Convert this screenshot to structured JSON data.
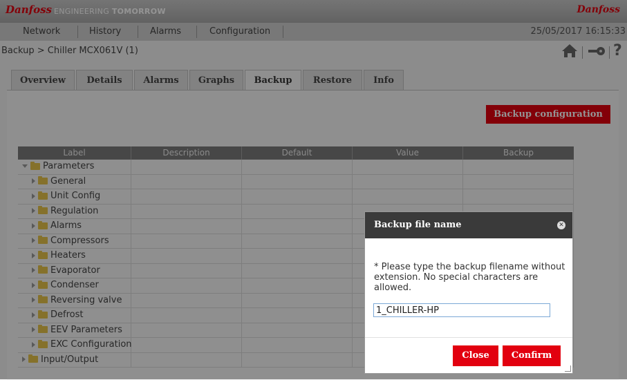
{
  "brand": {
    "logo_left": "Danfoss",
    "tagline_a": "ENGINEERING ",
    "tagline_b": "TOMORROW",
    "logo_right": "Danfoss",
    "accent": "#e2000f"
  },
  "menu": {
    "items": [
      "Network",
      "History",
      "Alarms",
      "Configuration"
    ],
    "datetime": "25/05/2017 16:15:33"
  },
  "breadcrumb": "Backup > Chiller MCX061V (1)",
  "header_icons": [
    "home-icon",
    "key-icon",
    "help-icon"
  ],
  "help_glyph": "?",
  "tabs": [
    {
      "label": "Overview"
    },
    {
      "label": "Details"
    },
    {
      "label": "Alarms"
    },
    {
      "label": "Graphs"
    },
    {
      "label": "Backup",
      "active": true
    },
    {
      "label": "Restore"
    },
    {
      "label": "Info"
    }
  ],
  "backup_button": "Backup configuration",
  "table": {
    "columns": [
      "Label",
      "Description",
      "Default",
      "Value",
      "Backup"
    ],
    "rows": [
      {
        "label": "Parameters",
        "level": 0,
        "expanded": true
      },
      {
        "label": "General",
        "level": 1
      },
      {
        "label": "Unit Config",
        "level": 1
      },
      {
        "label": "Regulation",
        "level": 1
      },
      {
        "label": "Alarms",
        "level": 1
      },
      {
        "label": "Compressors",
        "level": 1
      },
      {
        "label": "Heaters",
        "level": 1
      },
      {
        "label": "Evaporator",
        "level": 1
      },
      {
        "label": "Condenser",
        "level": 1
      },
      {
        "label": "Reversing valve",
        "level": 1
      },
      {
        "label": "Defrost",
        "level": 1
      },
      {
        "label": "EEV Parameters",
        "level": 1
      },
      {
        "label": "EXC Configuration",
        "level": 1
      },
      {
        "label": "Input/Output",
        "level": 0
      }
    ]
  },
  "dialog": {
    "title": "Backup file name",
    "message": "* Please type the backup filename without extension. No special characters are allowed.",
    "input_value": "1_CHILLER-HP",
    "close_label": "Close",
    "confirm_label": "Confirm"
  }
}
